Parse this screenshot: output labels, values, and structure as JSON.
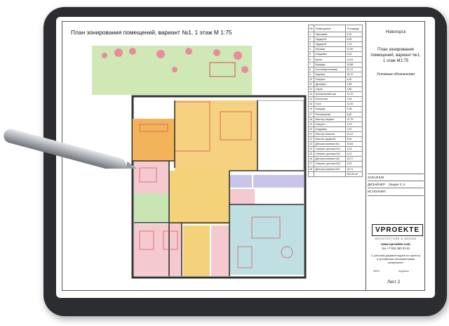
{
  "sheet": {
    "title": "План зонирования помещений, вариант №1, 1 этаж  М 1:75",
    "sheet_label": "Лист 2"
  },
  "side": {
    "city": "Новогорск",
    "plan_title": "План зонирования помещений, вариант №1, 1 этаж М1:75",
    "legend_title": "Условные обозначения",
    "rows": [
      {
        "label": "ЗАКАЗЧИК",
        "value": ""
      },
      {
        "label": "ДИЗАЙНЕР",
        "value": "Лащин С.А."
      },
      {
        "label": "ИСПОЛНИТ.",
        "value": ""
      }
    ],
    "logo": "VPROEKTE",
    "logo_sub": "ARCHITECTURE & DESIGN",
    "website": "www.vproekte.com",
    "phone": "тел.+7 915 450 01 91",
    "city_year": "Москва, 2023 год",
    "note": "С рабочей документацией по проекту и условными обозначениями ознакомлен:",
    "sign_name": "ФИО",
    "sign_sig": "подпись"
  },
  "table": {
    "headers": [
      "№",
      "Помещение",
      "Площадь"
    ],
    "rows": [
      [
        "1",
        "Прихожая",
        "9,91"
      ],
      [
        "2",
        "Гардероб",
        "8,30"
      ],
      [
        "3",
        "Гардероб",
        "1,76"
      ],
      [
        "4",
        "Игровая",
        "12,50"
      ],
      [
        "5",
        "Кладовая",
        "6,20"
      ],
      [
        "6",
        "Кухня",
        "14,61"
      ],
      [
        "7",
        "Коридор",
        "10,88"
      ],
      [
        "8",
        "Гостиная/столовая",
        "51,37"
      ],
      [
        "9",
        "Терраса",
        "46,70"
      ],
      [
        "10",
        "Санузел",
        "4,60"
      ],
      [
        "11",
        "Душевая",
        "2,89"
      ],
      [
        "12",
        "Сауна",
        "4,80"
      ],
      [
        "13",
        "Тренажерный зал",
        "10,70"
      ],
      [
        "14",
        "Котельная",
        "7,64"
      ],
      [
        "15",
        "Холл",
        "24,30"
      ],
      [
        "16",
        "Коридор",
        "2,06"
      ],
      [
        "17",
        "Постирочная",
        "6,60"
      ],
      [
        "18",
        "Мастер-санузел",
        "12,75"
      ],
      [
        "19",
        "Санузел",
        "1,29"
      ],
      [
        "20",
        "Кладовая",
        "1,87"
      ],
      [
        "21",
        "Мастер-спальня",
        "24,12"
      ],
      [
        "22",
        "Мастер-гардероб",
        "6,50"
      ],
      [
        "23",
        "Детская комната №1",
        "15,64"
      ],
      [
        "24",
        "Санузел, детская №1",
        "4,23"
      ],
      [
        "25",
        "Санузел, детская №2",
        "3,21"
      ],
      [
        "26",
        "Детская комната №2",
        "15,27"
      ],
      [
        "27",
        "Санузел, детская №3",
        "4,50"
      ],
      [
        "28",
        "Детская комната №3",
        "16,71"
      ],
      [
        "",
        "",
        "282,62 м²"
      ]
    ]
  },
  "colors": {
    "orange_zone": "#f2b35a",
    "green_zone": "#c9e5b4",
    "pink_zone": "#f4c9cf",
    "blue_zone": "#bfdfe3",
    "lavender_zone": "#c9c4ea",
    "yellow_zone": "#f3d27a",
    "tablet_frame": "#2b2d31"
  }
}
